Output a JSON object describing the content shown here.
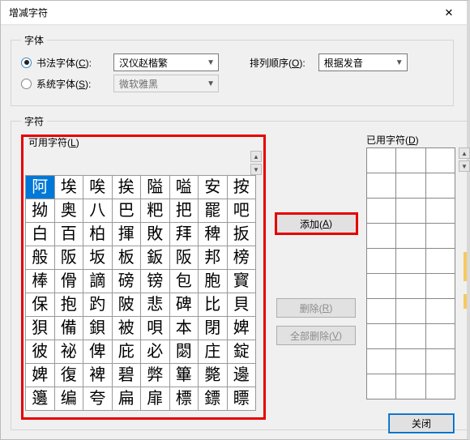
{
  "window": {
    "title": "增减字符",
    "close_x": "✕"
  },
  "groups": {
    "font_legend": "字体",
    "chars_legend": "字符"
  },
  "font": {
    "calligraphy_label_pre": "书法字体(",
    "calligraphy_label_u": "C",
    "calligraphy_label_post": "):",
    "calligraphy_value": "汉仪赵楷繁",
    "system_label_pre": "系统字体(",
    "system_label_u": "S",
    "system_label_post": "):",
    "system_value": "微软雅黑",
    "sort_label_pre": "排列顺序(",
    "sort_label_u": "O",
    "sort_label_post": "):",
    "sort_value": "根据发音"
  },
  "available": {
    "label_pre": "可用字符(",
    "label_u": "L",
    "label_post": ")",
    "rows": [
      [
        "阿",
        "埃",
        "唉",
        "挨",
        "隘",
        "嗌",
        "安",
        "按"
      ],
      [
        "拗",
        "奥",
        "八",
        "巴",
        "粑",
        "把",
        "罷",
        "吧"
      ],
      [
        "白",
        "百",
        "柏",
        "揮",
        "敗",
        "拜",
        "稗",
        "扳"
      ],
      [
        "般",
        "阪",
        "坂",
        "板",
        "鈑",
        "阪",
        "邦",
        "榜"
      ],
      [
        "棒",
        "傦",
        "謫",
        "磅",
        "镑",
        "包",
        "胞",
        "寳"
      ],
      [
        "保",
        "抱",
        "趵",
        "陂",
        "悲",
        "碑",
        "比",
        "貝"
      ],
      [
        "狽",
        "備",
        "鋇",
        "被",
        "唄",
        "本",
        "閉",
        "婢"
      ],
      [
        "彼",
        "祕",
        "俾",
        "庇",
        "必",
        "閟",
        "庄",
        "錠"
      ],
      [
        "婢",
        "復",
        "裨",
        "碧",
        "弊",
        "篳",
        "斃",
        "邊"
      ],
      [
        "籩",
        "编",
        "夸",
        "扁",
        "扉",
        "標",
        "鏢",
        "瞟"
      ]
    ]
  },
  "buttons": {
    "add_pre": "添加(",
    "add_u": "A",
    "add_post": ")",
    "remove_pre": "删除(",
    "remove_u": "R",
    "remove_post": ")",
    "remove_all_pre": "全部删除(",
    "remove_all_u": "V",
    "remove_all_post": ")",
    "close": "关闭"
  },
  "used": {
    "label_pre": "已用字符(",
    "label_u": "D",
    "label_post": ")",
    "rows": 10,
    "cols": 3
  }
}
